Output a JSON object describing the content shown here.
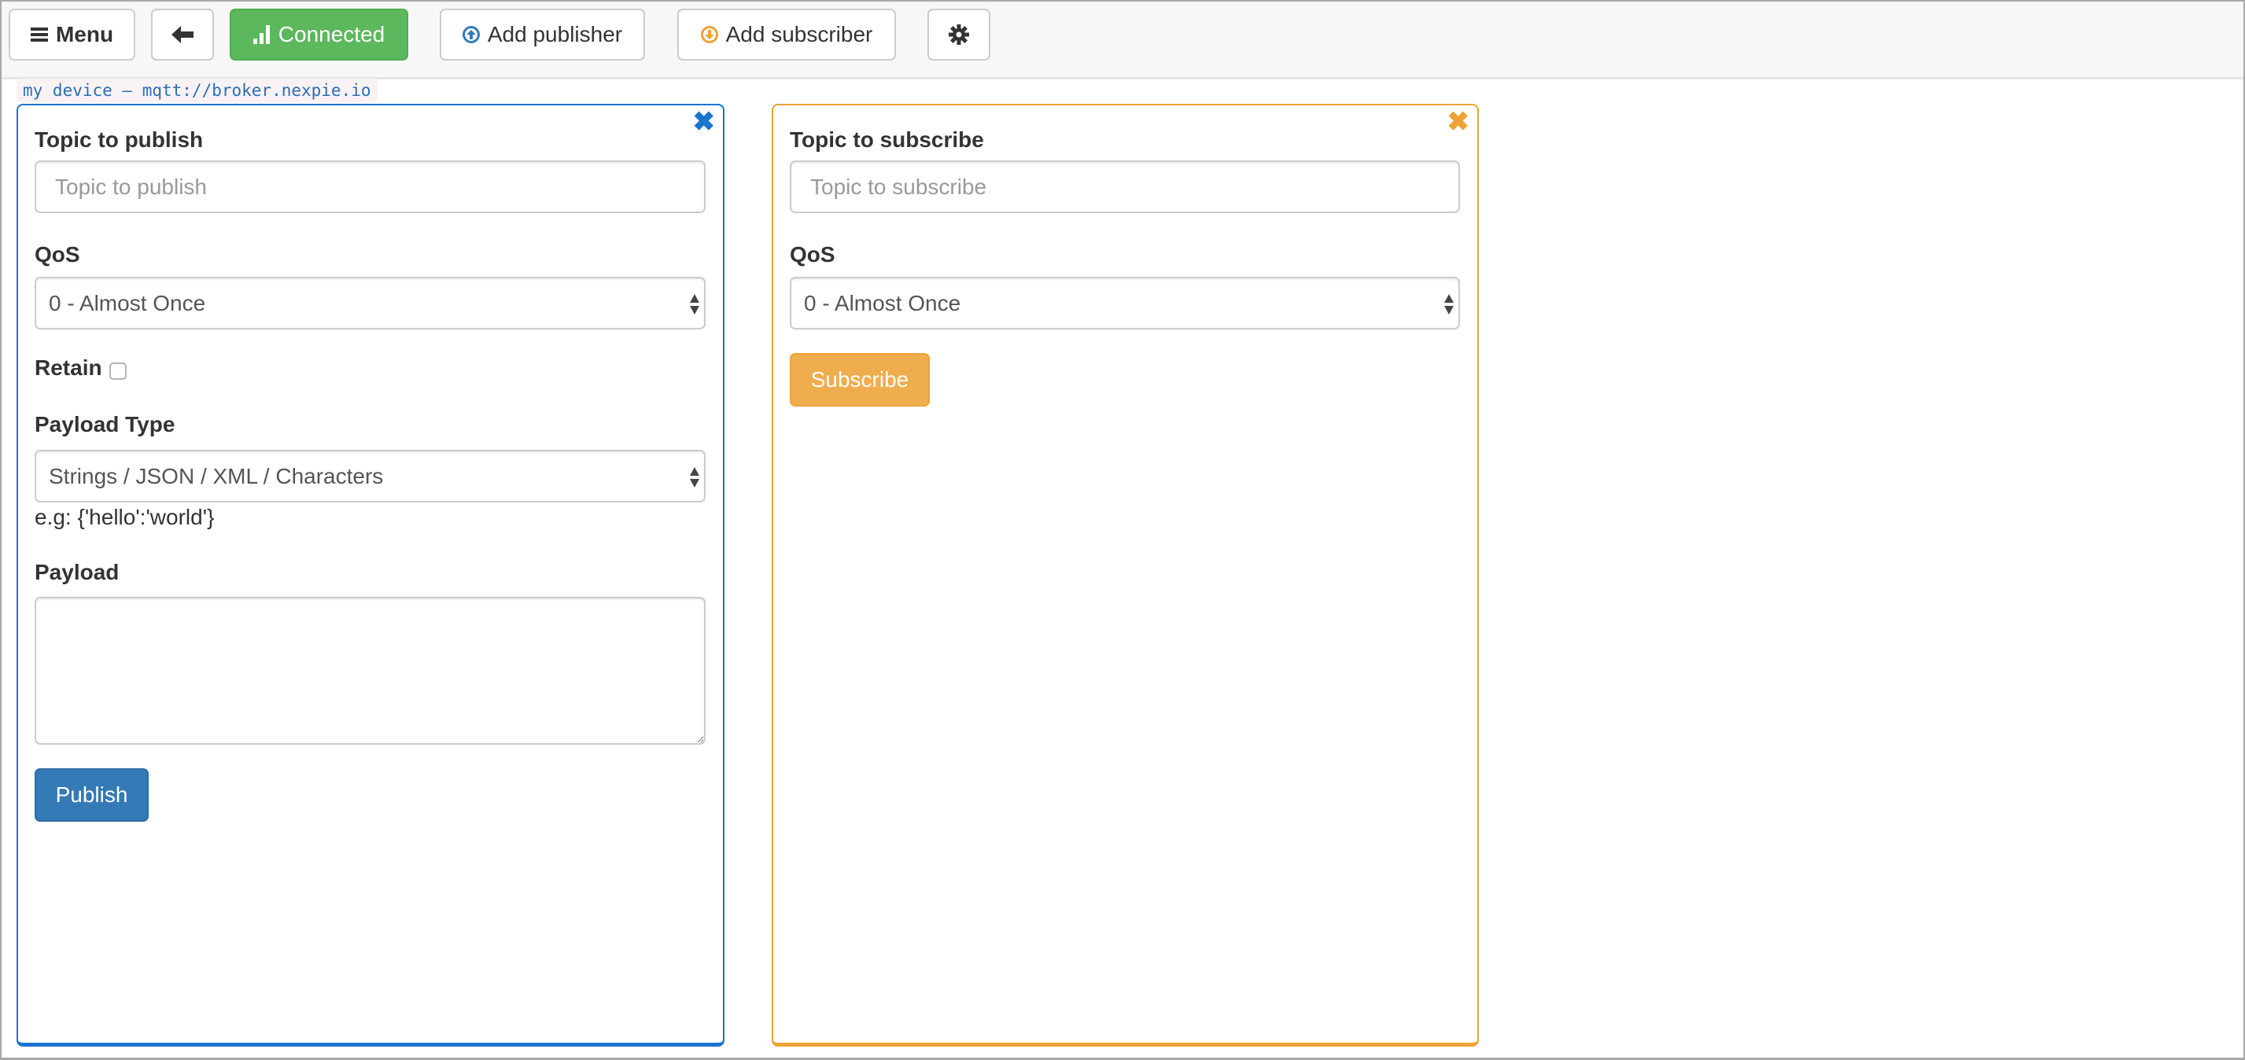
{
  "toolbar": {
    "menu_label": "Menu",
    "menu_icon": "hamburger-icon",
    "back_icon": "arrow-left-icon",
    "connection_status": "Connected",
    "connection_icon": "signal-icon",
    "connection_color": "#5cb85c",
    "add_publisher_label": "Add publisher",
    "add_publisher_icon": "circle-arrow-up-icon",
    "add_subscriber_label": "Add subscriber",
    "add_subscriber_icon": "circle-arrow-down-icon",
    "settings_icon": "gear-icon"
  },
  "connection": {
    "label": "my device – mqtt://broker.nexpie.io"
  },
  "publisher": {
    "accent_color": "#1a75cf",
    "topic_label": "Topic to publish",
    "topic_placeholder": "Topic to publish",
    "topic_value": "",
    "qos_label": "QoS",
    "qos_selected": "0 - Almost Once",
    "retain_label": "Retain",
    "retain_checked": false,
    "payload_type_label": "Payload Type",
    "payload_type_selected": "Strings / JSON / XML / Characters",
    "payload_hint": "e.g: {'hello':'world'}",
    "payload_label": "Payload",
    "payload_value": "",
    "publish_button": "Publish",
    "close_icon": "close-icon"
  },
  "subscriber": {
    "accent_color": "#eea236",
    "topic_label": "Topic to subscribe",
    "topic_placeholder": "Topic to subscribe",
    "topic_value": "",
    "qos_label": "QoS",
    "qos_selected": "0 - Almost Once",
    "subscribe_button": "Subscribe",
    "close_icon": "close-icon"
  }
}
